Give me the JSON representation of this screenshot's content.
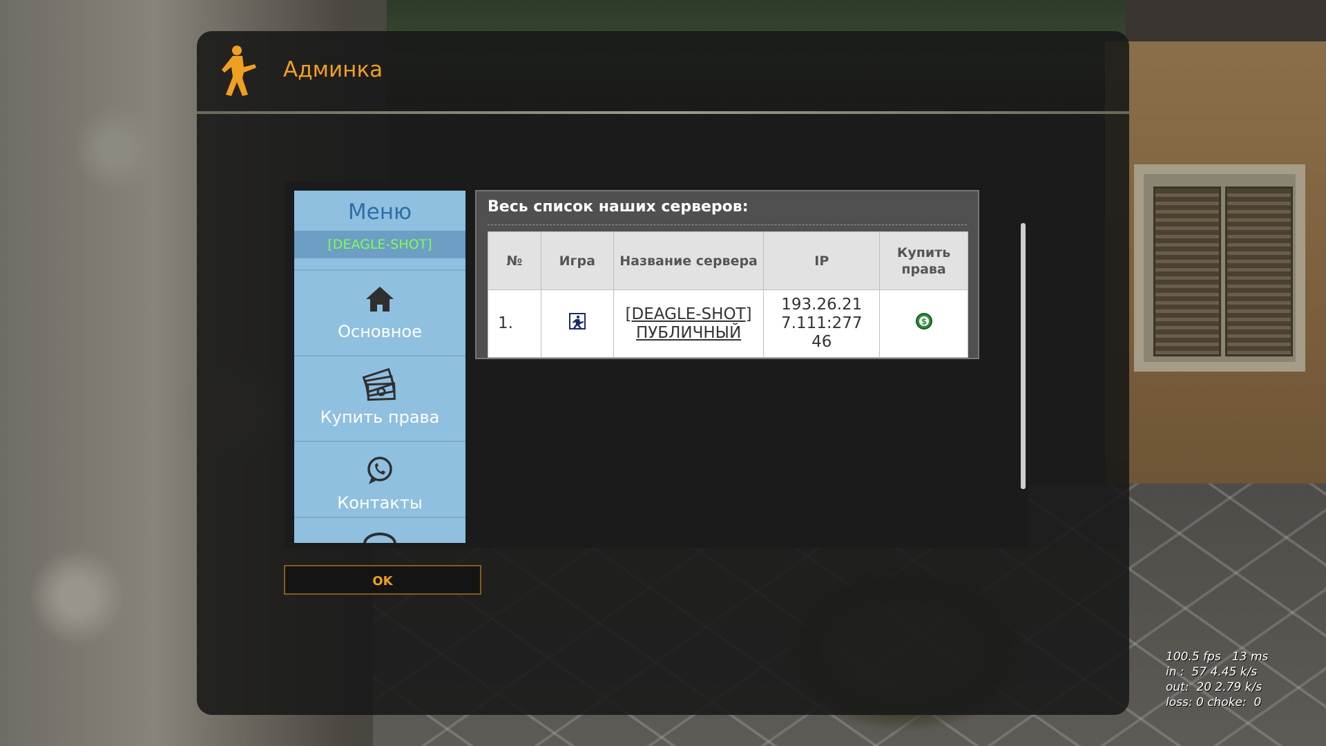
{
  "window": {
    "title": "Админка",
    "accent_color": "#f0a020"
  },
  "menu": {
    "title": "Меню",
    "server_tag": "[DEAGLE-SHOT]",
    "items": [
      {
        "label": "Основное",
        "icon": "home-icon"
      },
      {
        "label": "Купить права",
        "icon": "money-stack-icon"
      },
      {
        "label": "Контакты",
        "icon": "whatsapp-icon"
      },
      {
        "label": "",
        "icon": "chat-bubble-icon"
      }
    ]
  },
  "servers": {
    "heading": "Весь список наших серверов:",
    "columns": [
      "№",
      "Игра",
      "Название сервера",
      "IP",
      "Купить права"
    ],
    "rows": [
      {
        "num": "1.",
        "game_icon": "counter-strike-icon",
        "name": "[DEAGLE-SHOT] ПУБЛИЧНЫЙ",
        "ip": "193.26.217.111:27746",
        "buy_icon": "green-dollar-icon"
      }
    ]
  },
  "ok_button": {
    "label": "OK"
  },
  "netgraph": {
    "line1": "100.5 fps   13 ms",
    "line2": "in :  57 4.45 k/s",
    "line3": "out:  20 2.79 k/s",
    "line4": "loss: 0 choke:  0"
  }
}
